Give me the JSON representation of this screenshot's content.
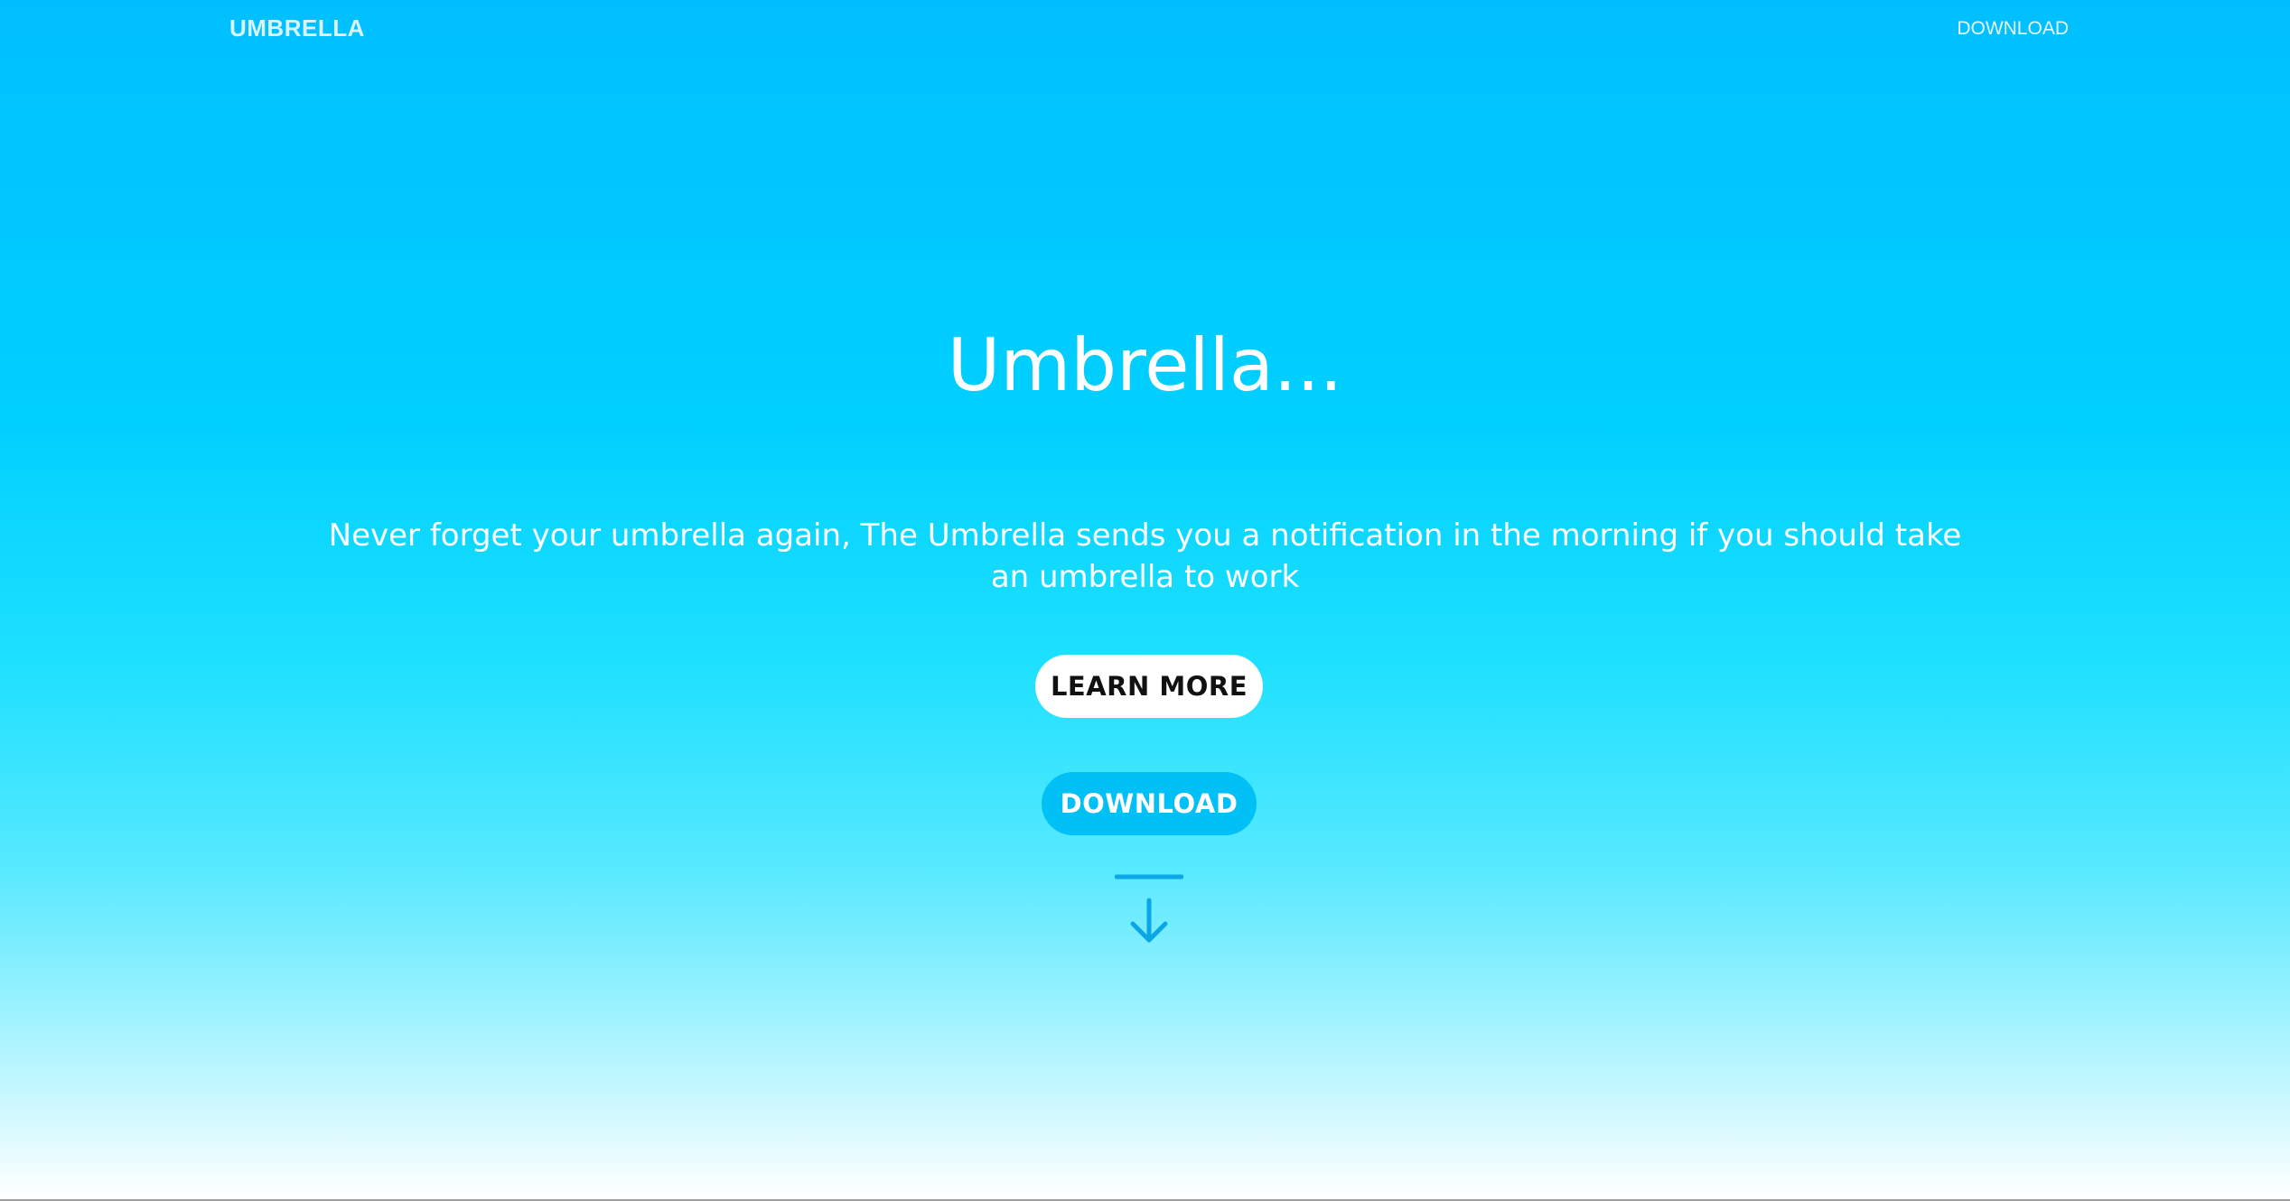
{
  "header": {
    "brand": "UMBRELLA",
    "nav_download": "DOWNLOAD"
  },
  "hero": {
    "title": "Umbrella...",
    "tagline": "Never forget your umbrella again, The Umbrella sends you a notification in the morning if you should take an umbrella to work",
    "learn_more_label": "LEARN MORE",
    "download_label": "DOWNLOAD",
    "scroll_icon": "arrow-down-to-line-icon"
  },
  "colors": {
    "gradient_top": "#00bfff",
    "gradient_bottom": "#ffffff",
    "download_button": "#00c0f5",
    "icon": "#0aa6e6"
  }
}
